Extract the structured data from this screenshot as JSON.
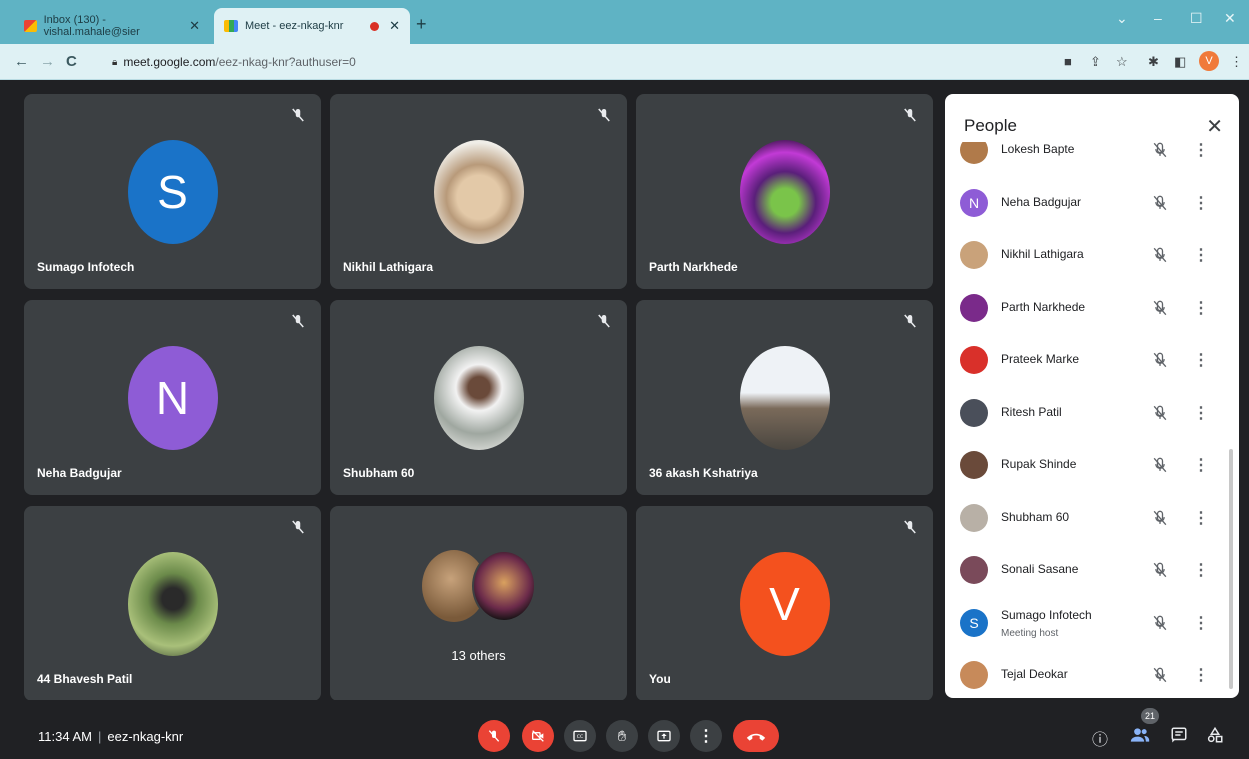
{
  "browser": {
    "tabs": [
      {
        "title": "Inbox (130) - vishal.mahale@sier",
        "active": false
      },
      {
        "title": "Meet - eez-nkag-knr",
        "active": true
      }
    ],
    "url_host": "meet.google.com",
    "url_path": "/eez-nkag-knr?authuser=0",
    "profile_initial": "V"
  },
  "tiles": [
    {
      "name": "Sumago Infotech",
      "avatar_type": "letter",
      "letter": "S",
      "color": "#1a73c8"
    },
    {
      "name": "Nikhil Lathigara",
      "avatar_type": "photo",
      "color": "#d8c7b2"
    },
    {
      "name": "Parth Narkhede",
      "avatar_type": "photo",
      "color": "#7a2a8a"
    },
    {
      "name": "Neha Badgujar",
      "avatar_type": "letter",
      "letter": "N",
      "color": "#8e5cd6"
    },
    {
      "name": "Shubham 60",
      "avatar_type": "photo",
      "color": "#b8b0a6"
    },
    {
      "name": "36 akash Kshatriya",
      "avatar_type": "photo",
      "color": "#8d8f93"
    },
    {
      "name": "44 Bhavesh Patil",
      "avatar_type": "photo",
      "color": "#6b8a4a"
    },
    {
      "name": "13 others",
      "avatar_type": "group"
    },
    {
      "name": "You",
      "avatar_type": "letter",
      "letter": "V",
      "color": "#f4511e"
    }
  ],
  "people_panel": {
    "title": "People",
    "participants": [
      {
        "name": "Lokesh Bapte",
        "sub": "",
        "avatar": "photo",
        "color": "#b07a4a"
      },
      {
        "name": "Neha Badgujar",
        "sub": "",
        "avatar": "letter",
        "letter": "N",
        "color": "#8e5cd6"
      },
      {
        "name": "Nikhil Lathigara",
        "sub": "",
        "avatar": "photo",
        "color": "#c9a27a"
      },
      {
        "name": "Parth Narkhede",
        "sub": "",
        "avatar": "photo",
        "color": "#7a2a8a"
      },
      {
        "name": "Prateek Marke",
        "sub": "",
        "avatar": "photo",
        "color": "#d9302a"
      },
      {
        "name": "Ritesh Patil",
        "sub": "",
        "avatar": "photo",
        "color": "#4a4f5a"
      },
      {
        "name": "Rupak Shinde",
        "sub": "",
        "avatar": "photo",
        "color": "#6a4a3a"
      },
      {
        "name": "Shubham 60",
        "sub": "",
        "avatar": "photo",
        "color": "#b8b0a6"
      },
      {
        "name": "Sonali Sasane",
        "sub": "",
        "avatar": "photo",
        "color": "#7a4a5a"
      },
      {
        "name": "Sumago Infotech",
        "sub": "Meeting host",
        "avatar": "letter",
        "letter": "S",
        "color": "#1a73c8"
      },
      {
        "name": "Tejal Deokar",
        "sub": "",
        "avatar": "photo",
        "color": "#c78a5a"
      }
    ]
  },
  "bottom_bar": {
    "time": "11:34 AM",
    "meeting_code": "eez-nkag-knr",
    "participant_count": "21"
  }
}
